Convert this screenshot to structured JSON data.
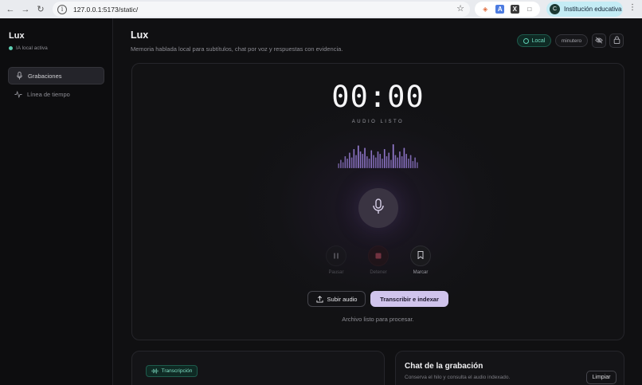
{
  "browser": {
    "url": "127.0.0.1:5173/static/",
    "profile_initial": "C",
    "profile_name": "Institución educativa"
  },
  "sidebar": {
    "brand": "Lux",
    "status": "IA local activa",
    "items": [
      {
        "label": "Grabaciones",
        "icon": "mic-icon",
        "active": true
      },
      {
        "label": "Línea de tiempo",
        "icon": "activity-icon",
        "active": false
      }
    ]
  },
  "header": {
    "title": "Lux",
    "subtitle": "Memoria hablada local para subtítulos, chat por voz y respuestas con evidencia.",
    "badge_local": "Local",
    "badge_granularity": "minutero"
  },
  "recorder": {
    "timer": "00:00",
    "status": "AUDIO LISTO",
    "controls": {
      "pause": "Pausar",
      "stop": "Detener",
      "mark": "Marcar"
    },
    "upload_label": "Subir audio",
    "transcribe_label": "Transcribir e indexar",
    "file_status": "Archivo listo para procesar.",
    "waveform_levels": [
      0.2,
      0.35,
      0.25,
      0.5,
      0.4,
      0.65,
      0.45,
      0.8,
      0.55,
      0.95,
      0.7,
      0.6,
      0.85,
      0.5,
      0.4,
      0.75,
      0.55,
      0.45,
      0.7,
      0.6,
      0.4,
      0.8,
      0.5,
      0.65,
      0.35,
      1.0,
      0.55,
      0.45,
      0.7,
      0.5,
      0.85,
      0.6,
      0.4,
      0.55,
      0.3,
      0.45,
      0.25
    ],
    "accent": "#9a7fd8"
  },
  "transcription": {
    "tag": "Transcripción"
  },
  "chat": {
    "title": "Chat de la grabación",
    "subtitle": "Conserva el hilo y consulta el audio indexado.",
    "clear_label": "Limpiar"
  }
}
